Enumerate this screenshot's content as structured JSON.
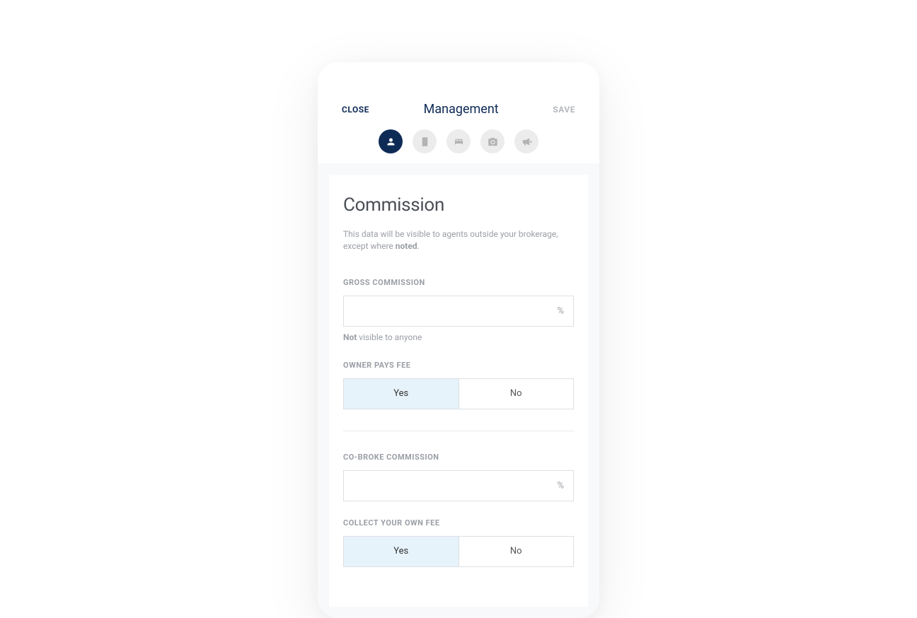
{
  "header": {
    "close": "CLOSE",
    "title": "Management",
    "save": "SAVE"
  },
  "tabs": [
    {
      "name": "person",
      "active": true
    },
    {
      "name": "building",
      "active": false
    },
    {
      "name": "bed",
      "active": false
    },
    {
      "name": "camera",
      "active": false
    },
    {
      "name": "megaphone",
      "active": false
    }
  ],
  "card": {
    "title": "Commission",
    "subtitle_pre": "This data will be visible to agents outside your brokerage, except where ",
    "subtitle_bold": "noted",
    "subtitle_post": "."
  },
  "fields": {
    "gross": {
      "label": "GROSS COMMISSION",
      "value": "",
      "suffix": "%",
      "hint_bold": "Not",
      "hint_rest": " visible to anyone"
    },
    "owner_pays": {
      "label": "OWNER PAYS FEE",
      "options": [
        "Yes",
        "No"
      ],
      "selected": "Yes"
    },
    "co_broke": {
      "label": "CO-BROKE COMMISSION",
      "value": "",
      "suffix": "%"
    },
    "collect_own": {
      "label": "COLLECT YOUR OWN FEE",
      "options": [
        "Yes",
        "No"
      ],
      "selected": "Yes"
    }
  }
}
